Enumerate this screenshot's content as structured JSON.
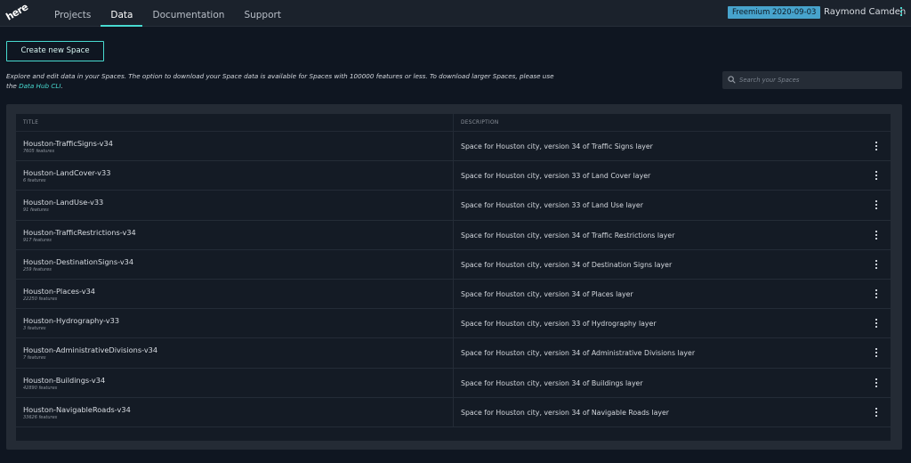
{
  "header": {
    "logo_text": "here",
    "nav": [
      "Projects",
      "Data",
      "Documentation",
      "Support"
    ],
    "active_nav": "Data",
    "plan_badge": "Freemium 2020-09-03",
    "user_name": "Raymond Camden"
  },
  "actions": {
    "create_space_label": "Create new Space"
  },
  "intro": {
    "text_before_link": "Explore and edit data in your Spaces. The option to download your Space data is available for Spaces with 100000 features or less. To download larger Spaces, please use the ",
    "link_text": "Data Hub CLI",
    "text_after_link": "."
  },
  "search": {
    "placeholder": "Search your Spaces"
  },
  "table": {
    "columns": [
      "TITLE",
      "DESCRIPTION"
    ],
    "rows": [
      {
        "title": "Houston-TrafficSigns-v34",
        "count": "7605 features",
        "description": "Space for Houston city, version 34 of Traffic Signs layer"
      },
      {
        "title": "Houston-LandCover-v33",
        "count": "6 features",
        "description": "Space for Houston city, version 33 of Land Cover layer"
      },
      {
        "title": "Houston-LandUse-v33",
        "count": "91 features",
        "description": "Space for Houston city, version 33 of Land Use layer"
      },
      {
        "title": "Houston-TrafficRestrictions-v34",
        "count": "917 features",
        "description": "Space for Houston city, version 34 of Traffic Restrictions layer"
      },
      {
        "title": "Houston-DestinationSigns-v34",
        "count": "259 features",
        "description": "Space for Houston city, version 34 of Destination Signs layer"
      },
      {
        "title": "Houston-Places-v34",
        "count": "22250 features",
        "description": "Space for Houston city, version 34 of Places layer"
      },
      {
        "title": "Houston-Hydrography-v33",
        "count": "3 features",
        "description": "Space for Houston city, version 33 of Hydrography layer"
      },
      {
        "title": "Houston-AdministrativeDivisions-v34",
        "count": "7 features",
        "description": "Space for Houston city, version 34 of Administrative Divisions layer"
      },
      {
        "title": "Houston-Buildings-v34",
        "count": "42890 features",
        "description": "Space for Houston city, version 34 of Buildings layer"
      },
      {
        "title": "Houston-NavigableRoads-v34",
        "count": "33626 features",
        "description": "Space for Houston city, version 34 of Navigable Roads layer"
      }
    ]
  },
  "colors": {
    "accent": "#48dad0",
    "badge": "#47a3cc",
    "background": "#0f1621"
  }
}
